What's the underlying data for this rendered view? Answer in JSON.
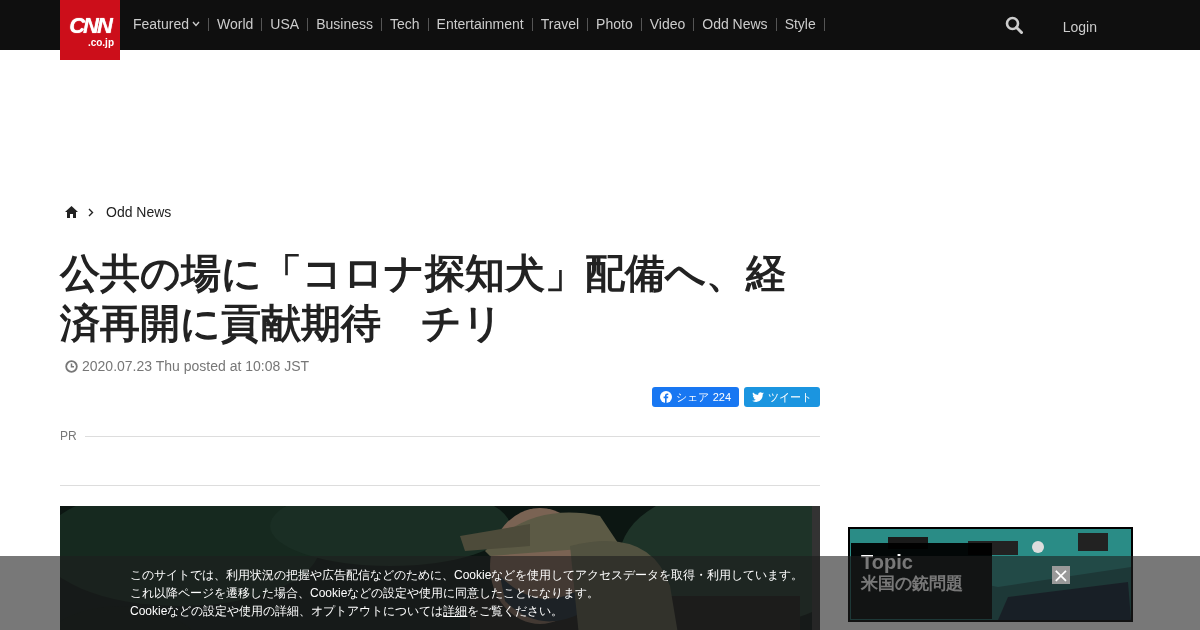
{
  "header": {
    "logo": {
      "main": "CNN",
      "sub": ".co.jp"
    },
    "nav": [
      {
        "label": "Featured",
        "kind": "dropdown"
      },
      {
        "label": "World",
        "kind": "link"
      },
      {
        "label": "USA",
        "kind": "link"
      },
      {
        "label": "Business",
        "kind": "link"
      },
      {
        "label": "Tech",
        "kind": "link"
      },
      {
        "label": "Entertainment",
        "kind": "link"
      },
      {
        "label": "Travel",
        "kind": "link"
      },
      {
        "label": "Photo",
        "kind": "link"
      },
      {
        "label": "Video",
        "kind": "link"
      },
      {
        "label": "Odd News",
        "kind": "link"
      },
      {
        "label": "Style",
        "kind": "link"
      }
    ],
    "login": "Login"
  },
  "breadcrumb": [
    "Odd News"
  ],
  "article": {
    "title": "公共の場に「コロナ探知犬」配備へ、経済再開に貢献期待　チリ",
    "date": "2020.07.23 Thu posted at 10:08 JST",
    "share": [
      {
        "kind": "facebook",
        "label": "シェア",
        "count": "224"
      },
      {
        "kind": "twitter",
        "label": "ツイート"
      }
    ],
    "pr_label": "PR"
  },
  "sidebar": {
    "banner": {
      "title": "Topic",
      "subtitle": "米国の銃問題"
    }
  },
  "cookie_notice": {
    "lines": [
      "このサイトでは、利用状況の把握や広告配信などのために、Cookieなどを使用してアクセスデータを取得・利用しています。",
      "これ以降ページを遷移した場合、Cookieなどの設定や使用に同意したことになります。"
    ],
    "last_line": {
      "before": "Cookieなどの設定や使用の詳細、オプトアウトについては",
      "link": "詳細",
      "after": "をご覧ください。"
    },
    "close": "×"
  }
}
